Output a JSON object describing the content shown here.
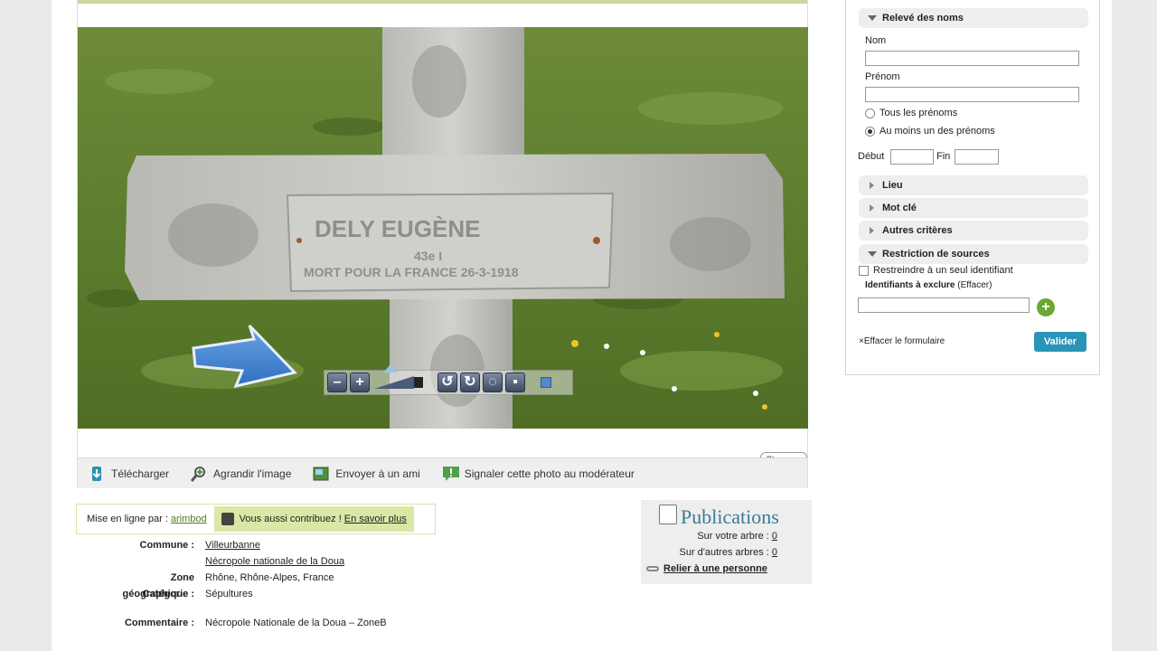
{
  "photo_actions": {
    "download": "Télécharger",
    "enlarge": "Agrandir l'image",
    "send": "Envoyer à un ami",
    "report": "Signaler cette photo au modérateur"
  },
  "photo": {
    "lock_label": "Bloquer...",
    "plaque_line1": "DELY      EUGÈNE",
    "plaque_line2": "43e I",
    "plaque_line3": "MORT POUR LA FRANCE 26-3-1918"
  },
  "uploader": {
    "prefix": "Mise en ligne par :",
    "user": "arimbod",
    "contrib_text": "Vous aussi contribuez !",
    "contrib_link": "En savoir plus"
  },
  "meta": {
    "commune_label": "Commune :",
    "commune": "Villeurbanne",
    "necropole": "Nécropole nationale de la Doua",
    "zone_label": "Zone géographique :",
    "zone": "Rhône, Rhône-Alpes, France",
    "categorie_label": "Catégorie :",
    "categorie": "Sépultures",
    "commentaire_label": "Commentaire :",
    "commentaire": "Nécropole Nationale de la Doua – ZoneB"
  },
  "publications": {
    "title": "Publications",
    "own_tree": "Sur votre arbre :",
    "own_count": "0",
    "other_trees": "Sur d'autres arbres :",
    "other_count": "0",
    "link": "Relier à une personne"
  },
  "sidebar": {
    "names_section": "Relevé des noms",
    "nom_label": "Nom",
    "prenom_label": "Prénom",
    "radio_all": "Tous les prénoms",
    "radio_one": "Au moins un des prénoms",
    "debut_label": "Début",
    "fin_label": "Fin",
    "lieu": "Lieu",
    "motcle": "Mot clé",
    "autres": "Autres critères",
    "restriction": "Restriction de sources",
    "restrict_chk": "Restreindre à un seul identifiant",
    "excl_label": "Identifiants à exclure",
    "excl_clear": "(Effacer)",
    "clear_form": "×Effacer le formulaire",
    "submit": "Valider"
  },
  "colors": {
    "accent_green": "#d9e8a6",
    "button_blue": "#2a94b8",
    "publications_title": "#3a7a9a"
  }
}
